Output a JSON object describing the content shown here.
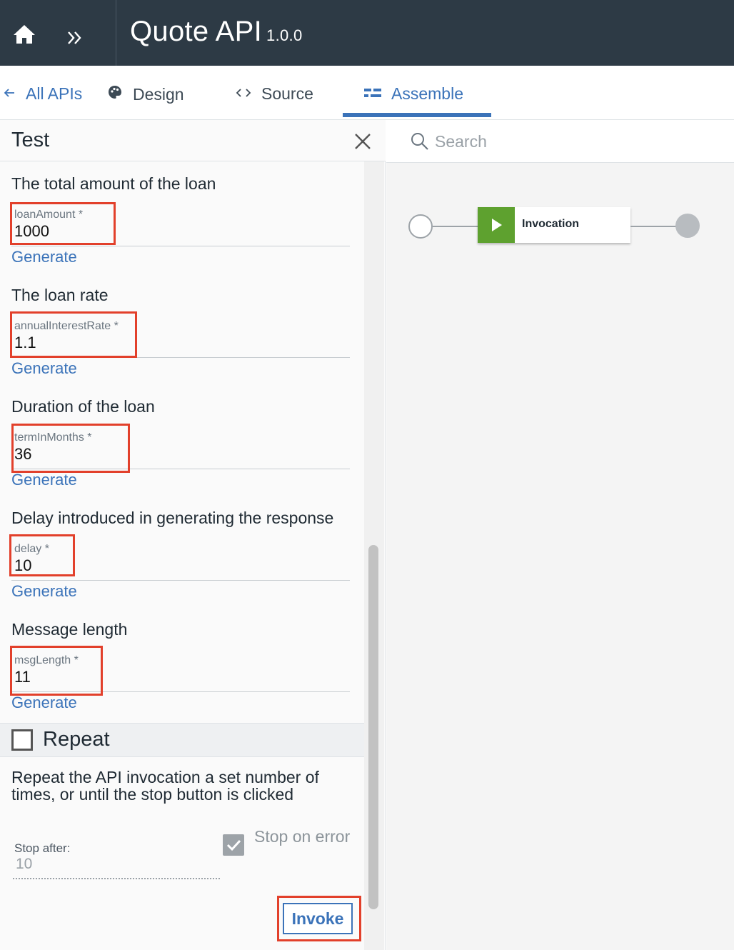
{
  "header": {
    "title": "Quote API",
    "version": "1.0.0"
  },
  "nav": {
    "all_apis": "All APIs",
    "design": "Design",
    "source": "Source",
    "assemble": "Assemble",
    "active_tab": "Assemble"
  },
  "test_panel": {
    "title": "Test",
    "params": [
      {
        "label": "The total amount of the loan",
        "name": "loanAmount *",
        "value": "1000",
        "generate": "Generate"
      },
      {
        "label": "The loan rate",
        "name": "annualInterestRate *",
        "value": "1.1",
        "generate": "Generate"
      },
      {
        "label": "Duration of the loan",
        "name": "termInMonths *",
        "value": "36",
        "generate": "Generate"
      },
      {
        "label": "Delay introduced in generating the response",
        "name": "delay *",
        "value": "10",
        "generate": "Generate"
      },
      {
        "label": "Message length",
        "name": "msgLength *",
        "value": "11",
        "generate": "Generate"
      }
    ],
    "repeat": {
      "label": "Repeat",
      "checked": false,
      "description": "Repeat the API invocation a set number of times, or until the stop button is clicked",
      "stop_after_label": "Stop after:",
      "stop_after_value": "10",
      "stop_on_error_label": "Stop on error",
      "stop_on_error_checked": true
    },
    "invoke_label": "Invoke"
  },
  "assembly": {
    "search_placeholder": "Search",
    "node_label": "Invocation",
    "node_color": "#5ea12f"
  },
  "colors": {
    "topbar": "#2d3a45",
    "accent": "#3b73b9",
    "highlight": "#e2402b"
  }
}
